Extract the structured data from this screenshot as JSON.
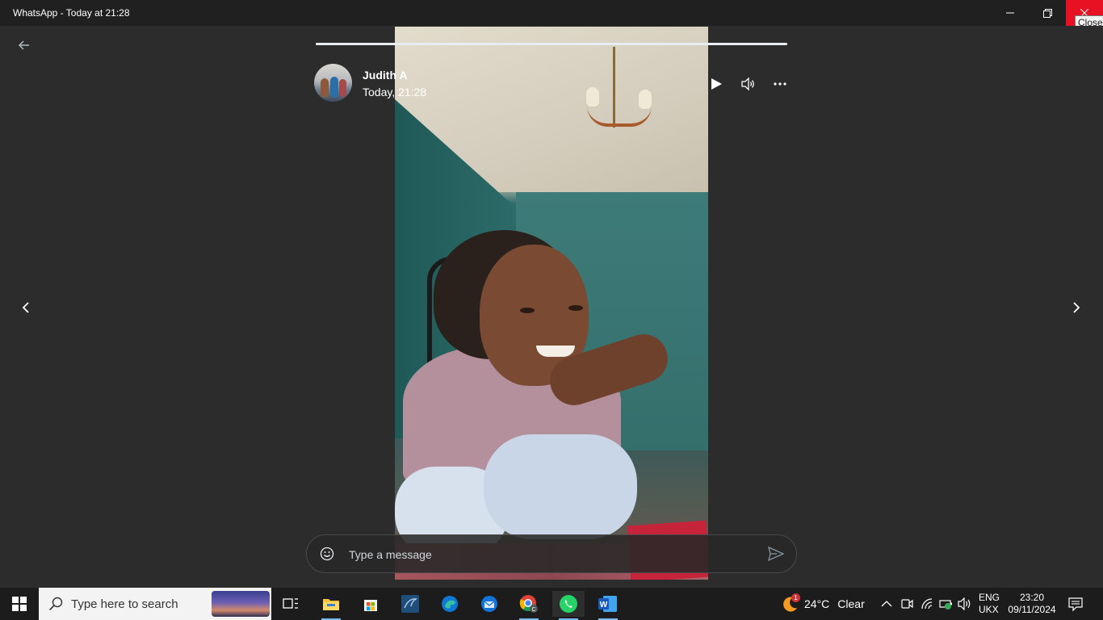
{
  "window": {
    "title": "WhatsApp - Today at 21:28",
    "close_tooltip": "Close"
  },
  "status": {
    "contact_name": "Judith A",
    "timestamp": "Today, 21:28",
    "progress_fraction": 1.0
  },
  "reply": {
    "placeholder": "Type a message"
  },
  "taskbar": {
    "search_placeholder": "Type here to search",
    "pinned_apps": [
      "task-view",
      "file-explorer",
      "microsoft-store",
      "mysql-workbench",
      "edge",
      "thunderbird",
      "chrome",
      "whatsapp",
      "word"
    ],
    "weather": {
      "temperature": "24°C",
      "condition": "Clear",
      "badge": "1"
    },
    "language": {
      "line1": "ENG",
      "line2": "UKX"
    },
    "clock": {
      "time": "23:20",
      "date": "09/11/2024"
    }
  },
  "colors": {
    "close_red": "#e81123",
    "taskbar": "#1c1c1c",
    "viewer_bg": "#2c2c2c",
    "whatsapp_green": "#25d366"
  }
}
